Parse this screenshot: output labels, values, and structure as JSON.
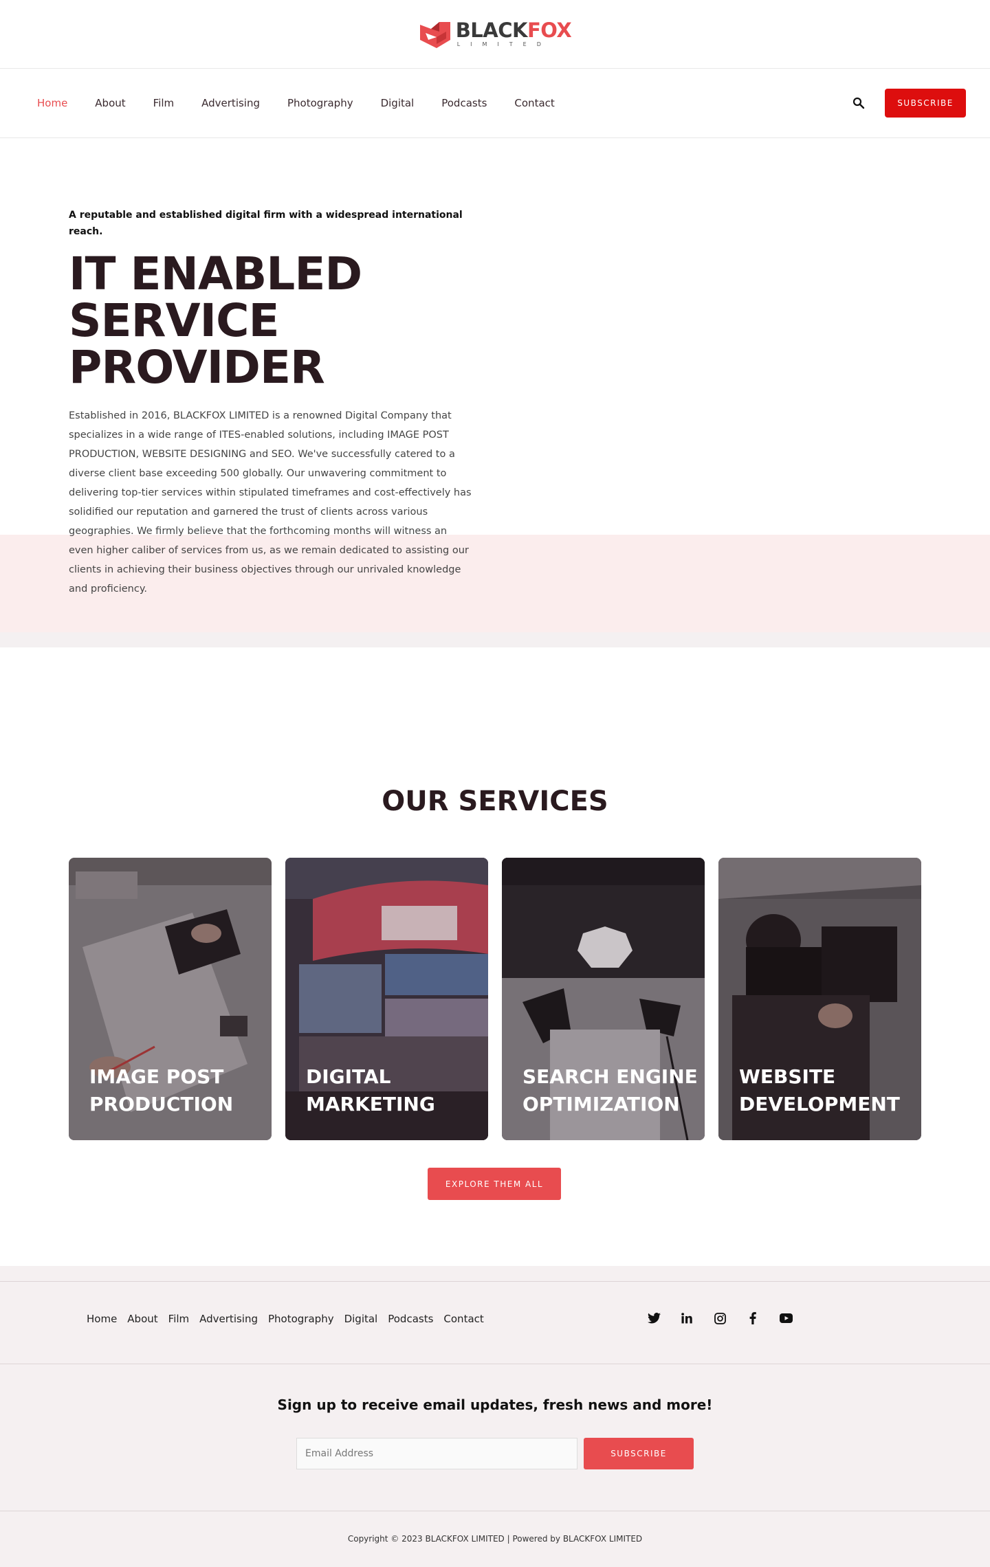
{
  "brand": {
    "name_black": "BLACK",
    "name_fox": "FOX",
    "sub": "LIMITED",
    "colors": {
      "accent": "#e84c4f",
      "subscribe_red": "#dd0e0e",
      "dark_text": "#2a1a1f",
      "band_pink": "#fbeded"
    }
  },
  "nav": {
    "items": [
      {
        "label": "Home",
        "active": true
      },
      {
        "label": "About"
      },
      {
        "label": "Film"
      },
      {
        "label": "Advertising"
      },
      {
        "label": "Photography"
      },
      {
        "label": "Digital"
      },
      {
        "label": "Podcasts"
      },
      {
        "label": "Contact"
      }
    ],
    "search_icon": "search-icon",
    "subscribe_label": "SUBSCRIBE"
  },
  "hero": {
    "eyebrow": "A reputable and established digital firm with a widespread international reach.",
    "title_line1": "IT ENABLED",
    "title_line2": "SERVICE",
    "title_line3": "PROVIDER",
    "body": "Established in 2016, BLACKFOX LIMITED is a renowned Digital Company that specializes in a wide range of ITES-enabled solutions, including IMAGE POST PRODUCTION, WEBSITE DESIGNING and SEO. We've successfully catered to a diverse client base exceeding 500 globally. Our unwavering commitment to delivering top-tier services within stipulated timeframes and cost-effectively has solidified our reputation and garnered the trust of clients across various geographies. We firmly believe that the forthcoming months will witness an even higher caliber of services from us, as we remain dedicated to assisting our clients in achieving their business objectives through our unrivaled knowledge and proficiency."
  },
  "services": {
    "title": "OUR SERVICES",
    "cards": [
      {
        "line1": "IMAGE POST",
        "line2": "PRODUCTION"
      },
      {
        "line1": "DIGITAL",
        "line2": "MARKETING"
      },
      {
        "line1": "SEARCH ENGINE",
        "line2": "OPTIMIZATION"
      },
      {
        "line1": "WEBSITE",
        "line2": "DEVELOPMENT"
      }
    ],
    "explore_label": "EXPLORE THEM ALL"
  },
  "footer": {
    "links": [
      "Home",
      "About",
      "Film",
      "Advertising",
      "Photography",
      "Digital",
      "Podcasts",
      "Contact"
    ],
    "social_icons": [
      "twitter-icon",
      "linkedin-icon",
      "instagram-icon",
      "facebook-icon",
      "youtube-icon"
    ],
    "signup_title": "Sign up to receive email updates, fresh news and more!",
    "email_placeholder": "Email Address",
    "signup_button": "SUBSCRIBE",
    "copyright": "Copyright © 2023 BLACKFOX LIMITED | Powered by BLACKFOX LIMITED"
  }
}
